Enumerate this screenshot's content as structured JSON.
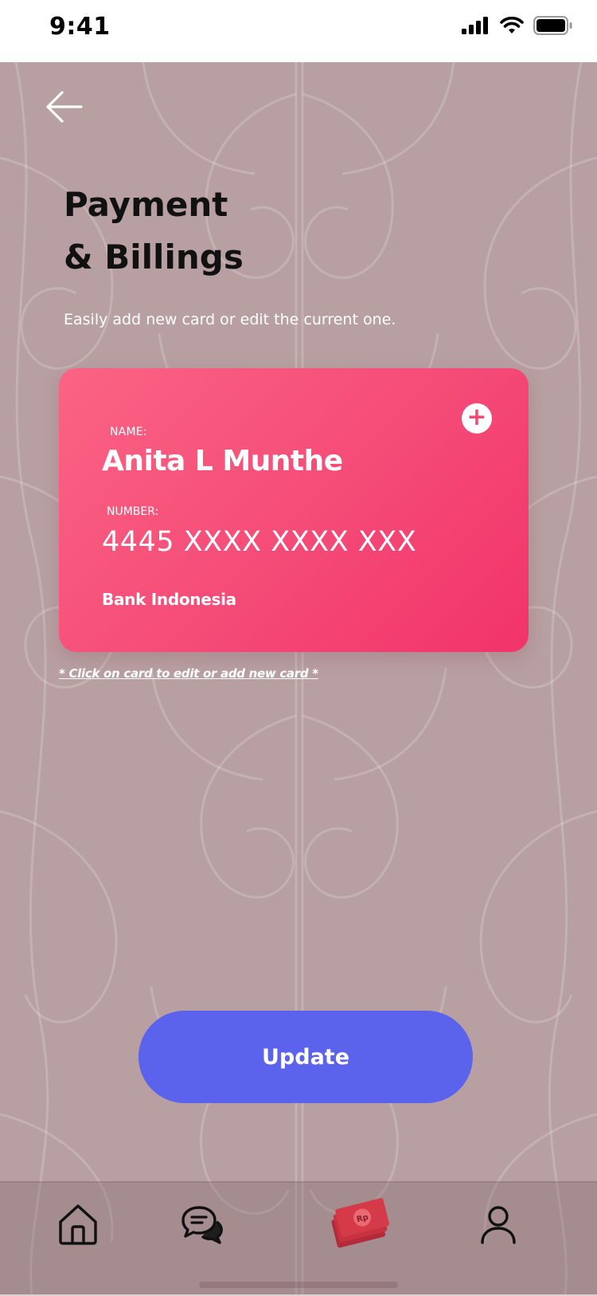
{
  "status_bar": {
    "time": "9:41",
    "icons": [
      "cellular-signal-icon",
      "wifi-icon",
      "battery-icon"
    ]
  },
  "header": {
    "back_icon": "arrow-left-icon",
    "title_line1": "Payment",
    "title_line2": "& Billings",
    "subtitle": "Easily add new card or edit the current one."
  },
  "card": {
    "name_label": "NAME:",
    "name": "Anita L Munthe",
    "number_label": "NUMBER:",
    "number": "4445 XXXX XXXX XXX",
    "bank": "Bank Indonesia",
    "add_icon": "plus-circle-icon",
    "gradient": [
      "#fb6384",
      "#f2336a"
    ]
  },
  "hint": "* Click on card to edit or add new card *",
  "update_button": {
    "label": "Update",
    "color": "#5b62eb"
  },
  "bottom_nav": {
    "items": [
      {
        "icon": "home-icon",
        "active": false
      },
      {
        "icon": "chat-icon",
        "active": false
      },
      {
        "icon": "money-icon",
        "active": true
      },
      {
        "icon": "user-icon",
        "active": false
      }
    ]
  },
  "colors": {
    "background": "#b8a0a2",
    "accent": "#f4486f",
    "button": "#5b62eb"
  }
}
